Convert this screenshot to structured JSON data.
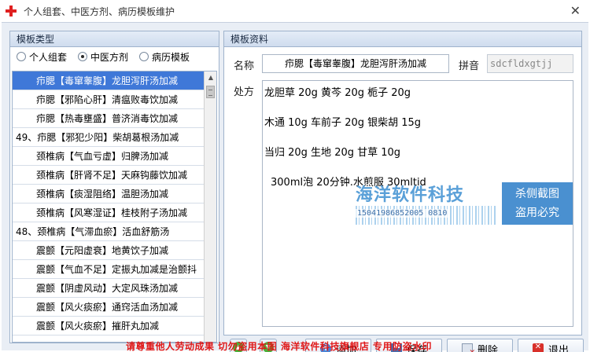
{
  "window": {
    "title": "个人组套、中医方剂、病历模板维护",
    "close_glyph": "✕"
  },
  "left": {
    "header": "模板类型",
    "radios": [
      {
        "label": "个人组套",
        "checked": false
      },
      {
        "label": "中医方剂",
        "checked": true
      },
      {
        "label": "病历模板",
        "checked": false
      }
    ],
    "items": [
      "疖腮【毒窜睾腹】龙胆泻肝汤加减",
      "疖腮【邪陷心肝】清瘟败毒饮加减",
      "疖腮【热毒壅盛】普济消毒饮加减",
      "49、疖腮【邪犯少阳】柴胡葛根汤加减",
      "颈椎病【气血亏虚】归脾汤加减",
      "颈椎病【肝肾不足】天麻钩藤饮加减",
      "颈椎病【痰湿阻络】温胆汤加减",
      "颈椎病【风寒湿证】桂枝附子汤加减",
      "48、颈椎病【气滞血瘀】活血舒筋汤",
      "震颤【元阳虚衰】地黄饮子加减",
      "震颤【气血不足】定振丸加减是治颤抖",
      "震颤【阴虚风动】大定风珠汤加减",
      "震颤【风火痰瘀】通窍活血汤加减",
      "震颤【风火痰瘀】摧肝丸加减"
    ],
    "selected_index": 0
  },
  "right": {
    "header": "模板资料",
    "name_label": "名称",
    "name_value": "疖腮【毒窜睾腹】龙胆泻肝汤加减",
    "pinyin_label": "拼音",
    "pinyin_value": "sdcfldxgtjj",
    "rx_label": "处方",
    "rx_lines": [
      "龙胆草 20g    黄芩 20g    栀子 20g",
      "木通 10g    车前子 20g    银柴胡 15g",
      "当归 20g    生地 20g    甘草 10g",
      "300ml泡 20分钟.水煎服 30mltid"
    ]
  },
  "watermark": {
    "brand": "海洋软件科技",
    "code": "15041986852005 0810",
    "stamp_line1": "杀侧截图",
    "stamp_line2": "盗用必究"
  },
  "buttons": {
    "up_glyph": "▲",
    "down_glyph": "▼",
    "add": "添加",
    "save": "保存",
    "delete": "删除",
    "exit": "退出"
  },
  "footer": "请尊重他人劳动成果    切勿盗用本图    海洋软件科技旗舰店    专用防盗水印"
}
